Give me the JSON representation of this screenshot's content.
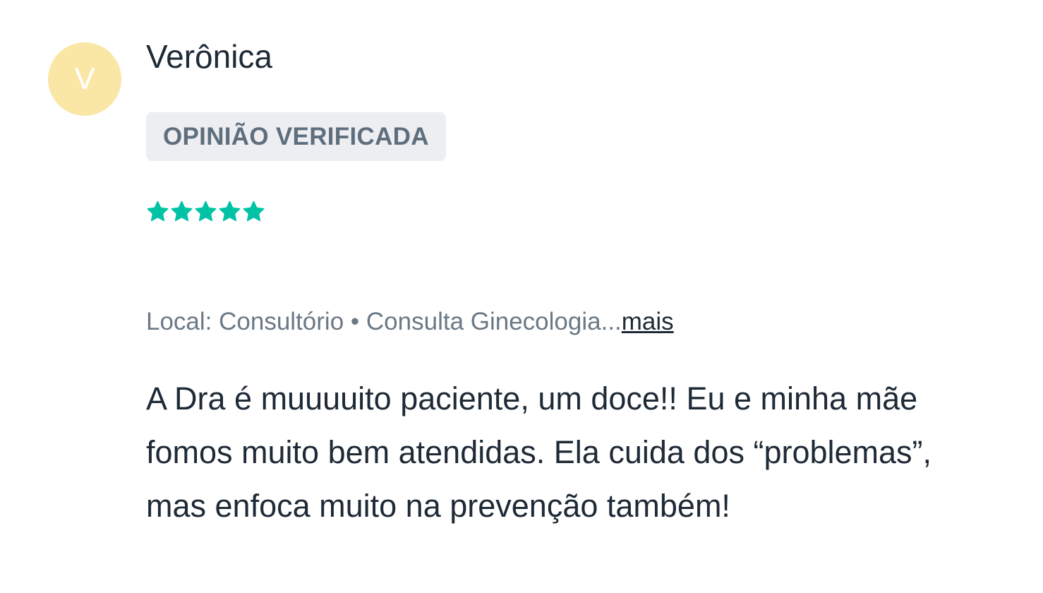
{
  "review": {
    "avatar_letter": "V",
    "author_name": "Verônica",
    "badge_label": "OPINIÃO VERIFICADA",
    "rating": 5,
    "rating_max": 5,
    "star_color": "#00c3a5",
    "avatar_color": "#fae7a6",
    "location": "Local: Consultório",
    "separator": "•",
    "service": "Consulta Ginecologia...",
    "more_link": "mais",
    "comment": "A Dra é muuuuito paciente, um doce!! Eu e minha mãe fomos muito bem atendidas. Ela cuida dos “problemas”, mas enfoca muito na prevenção também!"
  }
}
